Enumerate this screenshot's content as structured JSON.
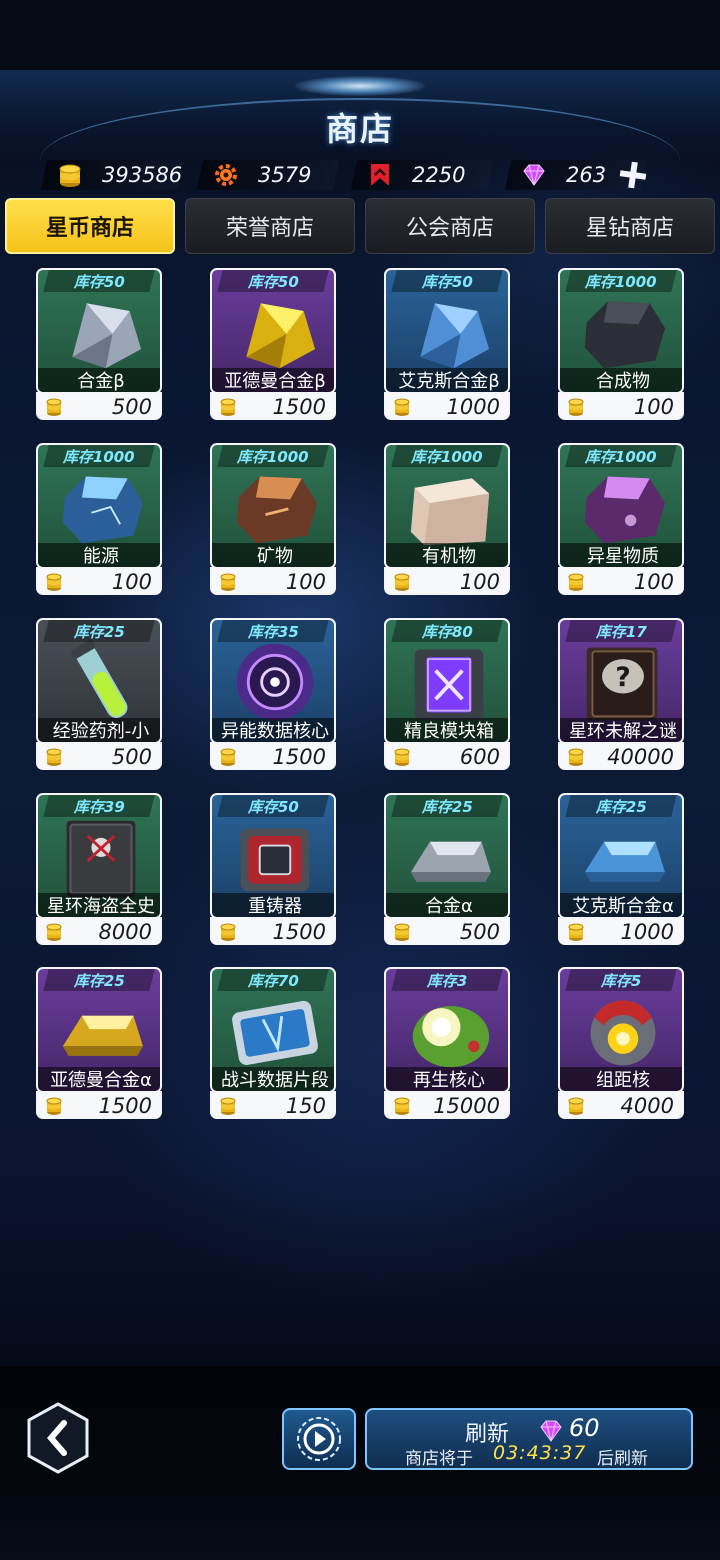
{
  "header": {
    "title": "商店"
  },
  "currencies": [
    {
      "icon": "gold-coin-icon",
      "value": "393586"
    },
    {
      "icon": "honor-gear-icon",
      "value": "3579"
    },
    {
      "icon": "guild-badge-icon",
      "value": "2250"
    },
    {
      "icon": "diamond-icon",
      "value": "263"
    }
  ],
  "tabs": [
    {
      "label": "星币商店",
      "active": true
    },
    {
      "label": "荣誉商店",
      "active": false
    },
    {
      "label": "公会商店",
      "active": false
    },
    {
      "label": "星钻商店",
      "active": false
    }
  ],
  "items": [
    {
      "stock": "库存50",
      "name": "合金β",
      "price": "500",
      "rarity": "green",
      "icon": "silver-crystal-icon"
    },
    {
      "stock": "库存50",
      "name": "亚德曼合金β",
      "price": "1500",
      "rarity": "purple",
      "icon": "gold-crystal-icon"
    },
    {
      "stock": "库存50",
      "name": "艾克斯合金β",
      "price": "1000",
      "rarity": "blue",
      "icon": "blue-crystal-icon"
    },
    {
      "stock": "库存1000",
      "name": "合成物",
      "price": "100",
      "rarity": "green",
      "icon": "dark-rock-icon"
    },
    {
      "stock": "库存1000",
      "name": "能源",
      "price": "100",
      "rarity": "green",
      "icon": "energy-rock-icon"
    },
    {
      "stock": "库存1000",
      "name": "矿物",
      "price": "100",
      "rarity": "green",
      "icon": "mineral-rock-icon"
    },
    {
      "stock": "库存1000",
      "name": "有机物",
      "price": "100",
      "rarity": "green",
      "icon": "organic-cube-icon"
    },
    {
      "stock": "库存1000",
      "name": "异星物质",
      "price": "100",
      "rarity": "green",
      "icon": "alien-rock-icon"
    },
    {
      "stock": "库存25",
      "name": "经验药剂-小",
      "price": "500",
      "rarity": "gray",
      "icon": "potion-tube-icon"
    },
    {
      "stock": "库存35",
      "name": "异能数据核心",
      "price": "1500",
      "rarity": "blue",
      "icon": "data-core-icon"
    },
    {
      "stock": "库存80",
      "name": "精良模块箱",
      "price": "600",
      "rarity": "green",
      "icon": "module-box-icon"
    },
    {
      "stock": "库存17",
      "name": "星环未解之谜",
      "price": "40000",
      "rarity": "purple",
      "icon": "mystery-book-icon"
    },
    {
      "stock": "库存39",
      "name": "星环海盗全史",
      "price": "8000",
      "rarity": "green",
      "icon": "pirate-book-icon"
    },
    {
      "stock": "库存50",
      "name": "重铸器",
      "price": "1500",
      "rarity": "blue",
      "icon": "reforger-icon"
    },
    {
      "stock": "库存25",
      "name": "合金α",
      "price": "500",
      "rarity": "green",
      "icon": "silver-ingot-icon"
    },
    {
      "stock": "库存25",
      "name": "艾克斯合金α",
      "price": "1000",
      "rarity": "blue",
      "icon": "blue-ingot-icon"
    },
    {
      "stock": "库存25",
      "name": "亚德曼合金α",
      "price": "1500",
      "rarity": "purple",
      "icon": "gold-ingot-icon"
    },
    {
      "stock": "库存70",
      "name": "战斗数据片段",
      "price": "150",
      "rarity": "green",
      "icon": "data-chip-icon"
    },
    {
      "stock": "库存3",
      "name": "再生核心",
      "price": "15000",
      "rarity": "purple",
      "icon": "regen-core-icon"
    },
    {
      "stock": "库存5",
      "name": "组距核",
      "price": "4000",
      "rarity": "purple",
      "icon": "range-core-icon"
    }
  ],
  "footer": {
    "refresh_label": "刷新",
    "refresh_cost": "60",
    "refresh_pre": "商店将于",
    "refresh_time": "03:43:37",
    "refresh_post": "后刷新"
  },
  "colors": {
    "accent_yellow": "#f6c21a",
    "stock_cyan": "#7fe8ff",
    "rarity_green": "#2f7456",
    "rarity_purple": "#6a3d9c",
    "rarity_blue": "#2a6398",
    "rarity_gray": "#4a5058"
  }
}
